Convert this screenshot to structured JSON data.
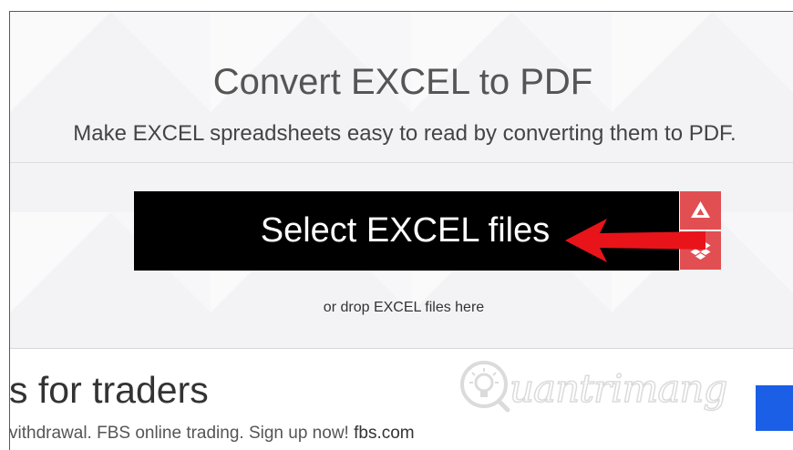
{
  "hero": {
    "title": "Convert EXCEL to PDF",
    "subtitle": "Make EXCEL spreadsheets easy to read by converting them to PDF."
  },
  "uploader": {
    "select_label": "Select EXCEL files",
    "drop_hint": "or drop EXCEL files here",
    "side_buttons": [
      {
        "icon": "google-drive-icon"
      },
      {
        "icon": "dropbox-icon"
      }
    ]
  },
  "ad": {
    "headline": "s for traders",
    "body": "vithdrawal. FBS online trading. Sign up now!",
    "domain": "fbs.com"
  },
  "watermark": {
    "text": "uantrimang"
  },
  "colors": {
    "primary_button": "#000000",
    "side_button": "#e14f53",
    "arrow": "#e8141a",
    "ad_cta": "#1a5fe6"
  }
}
